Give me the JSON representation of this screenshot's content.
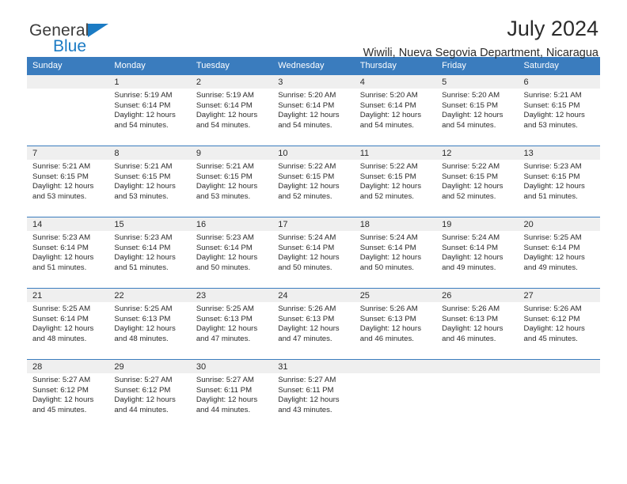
{
  "brand": {
    "name_part1": "General",
    "name_part2": "Blue",
    "triangle_icon": "triangle-icon",
    "colors": {
      "dark": "#3c3c3c",
      "blue": "#1b7bc4"
    }
  },
  "header": {
    "title": "July 2024",
    "subtitle": "Wiwili, Nueva Segovia Department, Nicaragua"
  },
  "theme": {
    "header_blue": "#3a7cbe",
    "daynum_strip": "#efefef",
    "text": "#2b2b2b"
  },
  "weekday_headers": [
    "Sunday",
    "Monday",
    "Tuesday",
    "Wednesday",
    "Thursday",
    "Friday",
    "Saturday"
  ],
  "weeks": [
    [
      {
        "day": "",
        "lines": []
      },
      {
        "day": "1",
        "lines": [
          "Sunrise: 5:19 AM",
          "Sunset: 6:14 PM",
          "Daylight: 12 hours",
          "and 54 minutes."
        ]
      },
      {
        "day": "2",
        "lines": [
          "Sunrise: 5:19 AM",
          "Sunset: 6:14 PM",
          "Daylight: 12 hours",
          "and 54 minutes."
        ]
      },
      {
        "day": "3",
        "lines": [
          "Sunrise: 5:20 AM",
          "Sunset: 6:14 PM",
          "Daylight: 12 hours",
          "and 54 minutes."
        ]
      },
      {
        "day": "4",
        "lines": [
          "Sunrise: 5:20 AM",
          "Sunset: 6:14 PM",
          "Daylight: 12 hours",
          "and 54 minutes."
        ]
      },
      {
        "day": "5",
        "lines": [
          "Sunrise: 5:20 AM",
          "Sunset: 6:15 PM",
          "Daylight: 12 hours",
          "and 54 minutes."
        ]
      },
      {
        "day": "6",
        "lines": [
          "Sunrise: 5:21 AM",
          "Sunset: 6:15 PM",
          "Daylight: 12 hours",
          "and 53 minutes."
        ]
      }
    ],
    [
      {
        "day": "7",
        "lines": [
          "Sunrise: 5:21 AM",
          "Sunset: 6:15 PM",
          "Daylight: 12 hours",
          "and 53 minutes."
        ]
      },
      {
        "day": "8",
        "lines": [
          "Sunrise: 5:21 AM",
          "Sunset: 6:15 PM",
          "Daylight: 12 hours",
          "and 53 minutes."
        ]
      },
      {
        "day": "9",
        "lines": [
          "Sunrise: 5:21 AM",
          "Sunset: 6:15 PM",
          "Daylight: 12 hours",
          "and 53 minutes."
        ]
      },
      {
        "day": "10",
        "lines": [
          "Sunrise: 5:22 AM",
          "Sunset: 6:15 PM",
          "Daylight: 12 hours",
          "and 52 minutes."
        ]
      },
      {
        "day": "11",
        "lines": [
          "Sunrise: 5:22 AM",
          "Sunset: 6:15 PM",
          "Daylight: 12 hours",
          "and 52 minutes."
        ]
      },
      {
        "day": "12",
        "lines": [
          "Sunrise: 5:22 AM",
          "Sunset: 6:15 PM",
          "Daylight: 12 hours",
          "and 52 minutes."
        ]
      },
      {
        "day": "13",
        "lines": [
          "Sunrise: 5:23 AM",
          "Sunset: 6:15 PM",
          "Daylight: 12 hours",
          "and 51 minutes."
        ]
      }
    ],
    [
      {
        "day": "14",
        "lines": [
          "Sunrise: 5:23 AM",
          "Sunset: 6:14 PM",
          "Daylight: 12 hours",
          "and 51 minutes."
        ]
      },
      {
        "day": "15",
        "lines": [
          "Sunrise: 5:23 AM",
          "Sunset: 6:14 PM",
          "Daylight: 12 hours",
          "and 51 minutes."
        ]
      },
      {
        "day": "16",
        "lines": [
          "Sunrise: 5:23 AM",
          "Sunset: 6:14 PM",
          "Daylight: 12 hours",
          "and 50 minutes."
        ]
      },
      {
        "day": "17",
        "lines": [
          "Sunrise: 5:24 AM",
          "Sunset: 6:14 PM",
          "Daylight: 12 hours",
          "and 50 minutes."
        ]
      },
      {
        "day": "18",
        "lines": [
          "Sunrise: 5:24 AM",
          "Sunset: 6:14 PM",
          "Daylight: 12 hours",
          "and 50 minutes."
        ]
      },
      {
        "day": "19",
        "lines": [
          "Sunrise: 5:24 AM",
          "Sunset: 6:14 PM",
          "Daylight: 12 hours",
          "and 49 minutes."
        ]
      },
      {
        "day": "20",
        "lines": [
          "Sunrise: 5:25 AM",
          "Sunset: 6:14 PM",
          "Daylight: 12 hours",
          "and 49 minutes."
        ]
      }
    ],
    [
      {
        "day": "21",
        "lines": [
          "Sunrise: 5:25 AM",
          "Sunset: 6:14 PM",
          "Daylight: 12 hours",
          "and 48 minutes."
        ]
      },
      {
        "day": "22",
        "lines": [
          "Sunrise: 5:25 AM",
          "Sunset: 6:13 PM",
          "Daylight: 12 hours",
          "and 48 minutes."
        ]
      },
      {
        "day": "23",
        "lines": [
          "Sunrise: 5:25 AM",
          "Sunset: 6:13 PM",
          "Daylight: 12 hours",
          "and 47 minutes."
        ]
      },
      {
        "day": "24",
        "lines": [
          "Sunrise: 5:26 AM",
          "Sunset: 6:13 PM",
          "Daylight: 12 hours",
          "and 47 minutes."
        ]
      },
      {
        "day": "25",
        "lines": [
          "Sunrise: 5:26 AM",
          "Sunset: 6:13 PM",
          "Daylight: 12 hours",
          "and 46 minutes."
        ]
      },
      {
        "day": "26",
        "lines": [
          "Sunrise: 5:26 AM",
          "Sunset: 6:13 PM",
          "Daylight: 12 hours",
          "and 46 minutes."
        ]
      },
      {
        "day": "27",
        "lines": [
          "Sunrise: 5:26 AM",
          "Sunset: 6:12 PM",
          "Daylight: 12 hours",
          "and 45 minutes."
        ]
      }
    ],
    [
      {
        "day": "28",
        "lines": [
          "Sunrise: 5:27 AM",
          "Sunset: 6:12 PM",
          "Daylight: 12 hours",
          "and 45 minutes."
        ]
      },
      {
        "day": "29",
        "lines": [
          "Sunrise: 5:27 AM",
          "Sunset: 6:12 PM",
          "Daylight: 12 hours",
          "and 44 minutes."
        ]
      },
      {
        "day": "30",
        "lines": [
          "Sunrise: 5:27 AM",
          "Sunset: 6:11 PM",
          "Daylight: 12 hours",
          "and 44 minutes."
        ]
      },
      {
        "day": "31",
        "lines": [
          "Sunrise: 5:27 AM",
          "Sunset: 6:11 PM",
          "Daylight: 12 hours",
          "and 43 minutes."
        ]
      },
      {
        "day": "",
        "lines": []
      },
      {
        "day": "",
        "lines": []
      },
      {
        "day": "",
        "lines": []
      }
    ]
  ]
}
